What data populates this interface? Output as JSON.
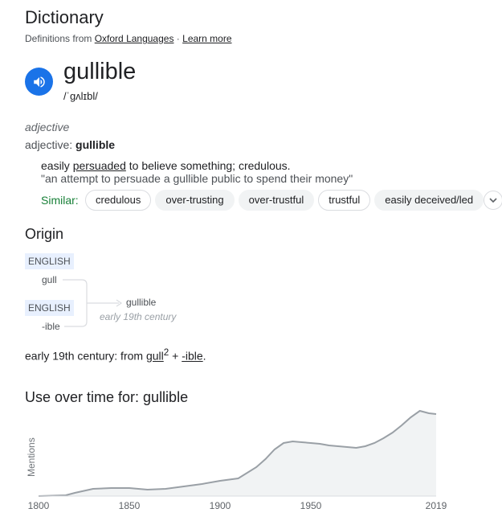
{
  "header": {
    "title": "Dictionary",
    "definitions_from": "Definitions from",
    "source_link": "Oxford Languages",
    "separator": " · ",
    "learn_more": "Learn more"
  },
  "entry": {
    "word": "gullible",
    "phonetic": "/ˈɡʌlɪbl/",
    "pos": "adjective",
    "inflection_label": "adjective: ",
    "inflection_word": "gullible",
    "definition_pre": "easily ",
    "definition_link": "persuaded",
    "definition_post": " to believe something; credulous.",
    "example": "\"an attempt to persuade a gullible public to spend their money\"",
    "similar_label": "Similar:",
    "similar": [
      "credulous",
      "over-trusting",
      "over-trustful",
      "trustful",
      "easily deceived/led"
    ]
  },
  "origin": {
    "title": "Origin",
    "lang1": "ENGLISH",
    "morph1": "gull",
    "lang2": "ENGLISH",
    "morph2": "-ible",
    "result_word": "gullible",
    "result_date": "early 19th century",
    "sentence_pre": "early 19th century: from ",
    "sentence_link1": "gull",
    "sentence_sup": "2",
    "sentence_plus": " + ",
    "sentence_link2": "-ible",
    "sentence_end": "."
  },
  "usage": {
    "title": "Use over time for: gullible",
    "ylabel": "Mentions"
  },
  "chart_data": {
    "type": "area",
    "title": "Use over time for: gullible",
    "ylabel": "Mentions",
    "xlabel": "",
    "x_ticks": [
      "1800",
      "1850",
      "1900",
      "1950",
      "2019"
    ],
    "xlim": [
      1800,
      2019
    ],
    "ylim": [
      0,
      1
    ],
    "color": "#9aa0a6",
    "fill": "#f1f3f4",
    "series": [
      {
        "x": [
          1800,
          1815,
          1820,
          1830,
          1840,
          1850,
          1860,
          1870,
          1880,
          1890,
          1900,
          1910,
          1920,
          1925,
          1930,
          1935,
          1940,
          1945,
          1950,
          1955,
          1960,
          1965,
          1970,
          1975,
          1980,
          1985,
          1990,
          1995,
          2000,
          2005,
          2010,
          2015,
          2019
        ],
        "values": [
          0.0,
          0.01,
          0.04,
          0.09,
          0.1,
          0.1,
          0.08,
          0.09,
          0.12,
          0.15,
          0.19,
          0.22,
          0.36,
          0.46,
          0.58,
          0.66,
          0.68,
          0.67,
          0.66,
          0.65,
          0.63,
          0.62,
          0.61,
          0.6,
          0.62,
          0.66,
          0.72,
          0.79,
          0.88,
          0.98,
          1.06,
          1.03,
          1.02
        ]
      }
    ]
  }
}
